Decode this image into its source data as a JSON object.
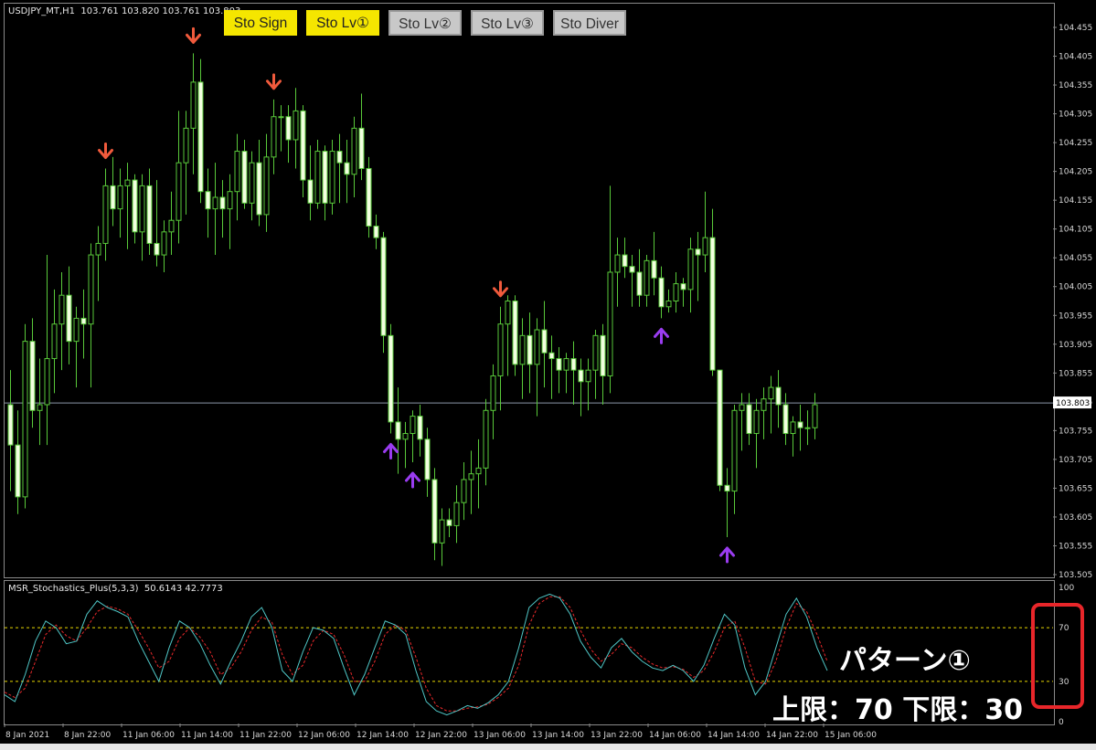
{
  "chart": {
    "symbol": "USDJPY_MT,H1",
    "ohlc": "103.761 103.820 103.761 103.803",
    "current_price_label": "103.803",
    "price_ticks": [
      "104.455",
      "104.405",
      "104.355",
      "104.305",
      "104.255",
      "104.205",
      "104.155",
      "104.105",
      "104.055",
      "104.005",
      "103.955",
      "103.905",
      "103.855",
      "103.805",
      "103.755",
      "103.705",
      "103.655",
      "103.605",
      "103.555",
      "103.505"
    ],
    "time_labels": [
      "8 Jan 2021",
      "8 Jan 22:00",
      "11 Jan 06:00",
      "11 Jan 14:00",
      "11 Jan 22:00",
      "12 Jan 06:00",
      "12 Jan 14:00",
      "12 Jan 22:00",
      "13 Jan 06:00",
      "13 Jan 14:00",
      "13 Jan 22:00",
      "14 Jan 06:00",
      "14 Jan 14:00",
      "14 Jan 22:00",
      "15 Jan 06:00"
    ],
    "colors": {
      "candle_bull_fill": "#000000",
      "candle_bear_fill": "#f2ffe0",
      "wick": "#59c93a",
      "sell_arrow": "#f05a3c",
      "buy_arrow": "#9a3cf0",
      "axis_text": "#d8d8d8",
      "price_line": "#8a97a8"
    }
  },
  "toolbar": {
    "buttons": [
      {
        "label": "Sto Sign",
        "state": "on"
      },
      {
        "label": "Sto Lv①",
        "state": "on"
      },
      {
        "label": "Sto Lv②",
        "state": "off"
      },
      {
        "label": "Sto Lv③",
        "state": "off"
      },
      {
        "label": "Sto Diver",
        "state": "off"
      }
    ]
  },
  "indicator": {
    "name": "MSR_Stochastics_Plus(5,3,3)",
    "values": "50.6143 42.7773",
    "levels": [
      "100",
      "70",
      "30",
      "0"
    ],
    "colors": {
      "main": "#4fc6c6",
      "signal": "#e8282a",
      "level_line": "#e8d800"
    }
  },
  "annotation": {
    "pattern": "パターン①",
    "limits": "上限：70 下限：30"
  },
  "chart_data": {
    "type": "candlestick",
    "title": "",
    "y_range": [
      103.505,
      104.455
    ],
    "upper_level": 70,
    "lower_level": 30,
    "ohlc": [
      [
        103.8,
        103.86,
        103.65,
        103.73
      ],
      [
        103.73,
        103.79,
        103.61,
        103.64
      ],
      [
        103.64,
        103.94,
        103.62,
        103.91
      ],
      [
        103.91,
        103.95,
        103.76,
        103.79
      ],
      [
        103.79,
        103.88,
        103.73,
        103.8
      ],
      [
        103.8,
        104.06,
        103.73,
        103.88
      ],
      [
        103.88,
        104.0,
        103.82,
        103.94
      ],
      [
        103.94,
        104.03,
        103.86,
        103.99
      ],
      [
        103.99,
        104.04,
        103.87,
        103.91
      ],
      [
        103.91,
        103.97,
        103.83,
        103.95
      ],
      [
        103.95,
        104.0,
        103.88,
        103.94
      ],
      [
        103.94,
        104.08,
        103.83,
        104.06
      ],
      [
        104.06,
        104.11,
        103.98,
        104.08
      ],
      [
        104.08,
        104.21,
        104.05,
        104.18
      ],
      [
        104.18,
        104.23,
        104.11,
        104.14
      ],
      [
        104.14,
        104.21,
        104.09,
        104.18
      ],
      [
        104.18,
        104.22,
        104.07,
        104.19
      ],
      [
        104.19,
        104.2,
        104.08,
        104.1
      ],
      [
        104.1,
        104.2,
        104.05,
        104.18
      ],
      [
        104.18,
        104.21,
        104.06,
        104.08
      ],
      [
        104.08,
        104.19,
        104.04,
        104.06
      ],
      [
        104.06,
        104.12,
        104.03,
        104.1
      ],
      [
        104.1,
        104.17,
        104.06,
        104.12
      ],
      [
        104.12,
        104.31,
        104.08,
        104.22
      ],
      [
        104.22,
        104.31,
        104.13,
        104.28
      ],
      [
        104.28,
        104.41,
        104.2,
        104.36
      ],
      [
        104.36,
        104.4,
        104.15,
        104.17
      ],
      [
        104.17,
        104.21,
        104.09,
        104.14
      ],
      [
        104.14,
        104.22,
        104.06,
        104.16
      ],
      [
        104.16,
        104.19,
        104.09,
        104.14
      ],
      [
        104.14,
        104.2,
        104.07,
        104.17
      ],
      [
        104.17,
        104.27,
        104.12,
        104.24
      ],
      [
        104.24,
        104.26,
        104.14,
        104.15
      ],
      [
        104.15,
        104.24,
        104.12,
        104.22
      ],
      [
        104.22,
        104.26,
        104.11,
        104.13
      ],
      [
        104.13,
        104.27,
        104.1,
        104.23
      ],
      [
        104.23,
        104.33,
        104.2,
        104.3
      ],
      [
        104.3,
        104.32,
        104.24,
        104.3
      ],
      [
        104.3,
        104.32,
        104.22,
        104.26
      ],
      [
        104.26,
        104.35,
        104.21,
        104.31
      ],
      [
        104.31,
        104.32,
        104.16,
        104.19
      ],
      [
        104.19,
        104.25,
        104.12,
        104.15
      ],
      [
        104.15,
        104.26,
        104.14,
        104.24
      ],
      [
        104.24,
        104.25,
        104.12,
        104.15
      ],
      [
        104.15,
        104.26,
        104.13,
        104.24
      ],
      [
        104.24,
        104.27,
        104.15,
        104.22
      ],
      [
        104.22,
        104.26,
        104.15,
        104.2
      ],
      [
        104.2,
        104.3,
        104.16,
        104.28
      ],
      [
        104.28,
        104.34,
        104.19,
        104.21
      ],
      [
        104.21,
        104.23,
        104.09,
        104.11
      ],
      [
        104.11,
        104.13,
        104.07,
        104.09
      ],
      [
        104.09,
        104.1,
        103.89,
        103.92
      ],
      [
        103.92,
        103.94,
        103.75,
        103.77
      ],
      [
        103.77,
        103.83,
        103.68,
        103.74
      ],
      [
        103.74,
        103.77,
        103.69,
        103.75
      ],
      [
        103.75,
        103.79,
        103.7,
        103.78
      ],
      [
        103.78,
        103.8,
        103.71,
        103.74
      ],
      [
        103.74,
        103.76,
        103.64,
        103.67
      ],
      [
        103.67,
        103.69,
        103.53,
        103.56
      ],
      [
        103.56,
        103.62,
        103.52,
        103.6
      ],
      [
        103.6,
        103.62,
        103.57,
        103.59
      ],
      [
        103.59,
        103.66,
        103.56,
        103.63
      ],
      [
        103.63,
        103.7,
        103.6,
        103.67
      ],
      [
        103.67,
        103.72,
        103.61,
        103.68
      ],
      [
        103.68,
        103.74,
        103.62,
        103.69
      ],
      [
        103.69,
        103.81,
        103.66,
        103.79
      ],
      [
        103.79,
        103.87,
        103.74,
        103.85
      ],
      [
        103.85,
        103.97,
        103.79,
        103.94
      ],
      [
        103.94,
        103.99,
        103.85,
        103.98
      ],
      [
        103.98,
        103.99,
        103.85,
        103.87
      ],
      [
        103.87,
        103.95,
        103.81,
        103.92
      ],
      [
        103.92,
        103.96,
        103.82,
        103.87
      ],
      [
        103.87,
        103.95,
        103.78,
        103.93
      ],
      [
        103.93,
        103.98,
        103.83,
        103.89
      ],
      [
        103.89,
        103.92,
        103.81,
        103.88
      ],
      [
        103.88,
        103.9,
        103.82,
        103.86
      ],
      [
        103.86,
        103.89,
        103.82,
        103.88
      ],
      [
        103.88,
        103.91,
        103.8,
        103.86
      ],
      [
        103.86,
        103.88,
        103.78,
        103.84
      ],
      [
        103.84,
        103.88,
        103.79,
        103.86
      ],
      [
        103.86,
        103.93,
        103.81,
        103.92
      ],
      [
        103.92,
        103.94,
        103.8,
        103.85
      ],
      [
        103.85,
        104.18,
        103.82,
        104.03
      ],
      [
        104.03,
        104.09,
        103.97,
        104.06
      ],
      [
        104.06,
        104.09,
        104.02,
        104.04
      ],
      [
        104.04,
        104.06,
        103.97,
        104.03
      ],
      [
        104.03,
        104.07,
        103.97,
        103.99
      ],
      [
        103.99,
        104.06,
        103.97,
        104.05
      ],
      [
        104.05,
        104.1,
        103.99,
        104.02
      ],
      [
        104.02,
        104.04,
        103.95,
        103.97
      ],
      [
        103.97,
        104.0,
        103.96,
        103.98
      ],
      [
        103.98,
        104.03,
        103.96,
        104.01
      ],
      [
        104.01,
        104.02,
        103.97,
        104.0
      ],
      [
        104.0,
        104.09,
        103.96,
        104.07
      ],
      [
        104.07,
        104.1,
        103.98,
        104.06
      ],
      [
        104.06,
        104.17,
        104.03,
        104.09
      ],
      [
        104.09,
        104.14,
        103.85,
        103.86
      ],
      [
        103.86,
        103.86,
        103.65,
        103.66
      ],
      [
        103.66,
        103.69,
        103.57,
        103.65
      ],
      [
        103.65,
        103.8,
        103.61,
        103.79
      ],
      [
        103.79,
        103.82,
        103.72,
        103.8
      ],
      [
        103.8,
        103.82,
        103.73,
        103.75
      ],
      [
        103.75,
        103.81,
        103.69,
        103.79
      ],
      [
        103.79,
        103.83,
        103.74,
        103.81
      ],
      [
        103.81,
        103.85,
        103.75,
        103.83
      ],
      [
        103.83,
        103.86,
        103.76,
        103.8
      ],
      [
        103.8,
        103.82,
        103.73,
        103.75
      ],
      [
        103.75,
        103.78,
        103.71,
        103.77
      ],
      [
        103.77,
        103.8,
        103.72,
        103.76
      ],
      [
        103.76,
        103.79,
        103.73,
        103.76
      ],
      [
        103.76,
        103.82,
        103.74,
        103.8
      ]
    ],
    "sell_arrows": [
      {
        "i": 13
      },
      {
        "i": 25
      },
      {
        "i": 36
      },
      {
        "i": 67
      }
    ],
    "buy_arrows": [
      {
        "i": 52
      },
      {
        "i": 55
      },
      {
        "i": 89
      },
      {
        "i": 98
      }
    ],
    "stoch_main": [
      20,
      15,
      35,
      60,
      75,
      70,
      58,
      60,
      80,
      90,
      85,
      82,
      78,
      60,
      45,
      30,
      55,
      75,
      70,
      58,
      42,
      28,
      45,
      60,
      78,
      85,
      70,
      38,
      30,
      52,
      70,
      68,
      62,
      40,
      20,
      35,
      55,
      75,
      72,
      65,
      38,
      15,
      8,
      5,
      8,
      12,
      10,
      14,
      20,
      30,
      55,
      85,
      92,
      95,
      92,
      80,
      60,
      48,
      40,
      55,
      62,
      52,
      45,
      40,
      38,
      42,
      38,
      30,
      42,
      62,
      80,
      72,
      40,
      20,
      30,
      55,
      80,
      92,
      78,
      55,
      38
    ],
    "stoch_signal": [
      22,
      18,
      25,
      45,
      65,
      72,
      64,
      60,
      70,
      82,
      86,
      84,
      80,
      68,
      55,
      40,
      45,
      62,
      70,
      63,
      52,
      35,
      40,
      52,
      68,
      78,
      74,
      50,
      35,
      42,
      60,
      68,
      65,
      50,
      30,
      30,
      45,
      65,
      72,
      68,
      48,
      25,
      12,
      8,
      8,
      10,
      11,
      13,
      18,
      25,
      42,
      72,
      88,
      93,
      93,
      85,
      68,
      54,
      45,
      50,
      58,
      55,
      48,
      43,
      40,
      41,
      39,
      33,
      38,
      52,
      70,
      75,
      55,
      30,
      28,
      45,
      70,
      88,
      82,
      65,
      45
    ]
  }
}
